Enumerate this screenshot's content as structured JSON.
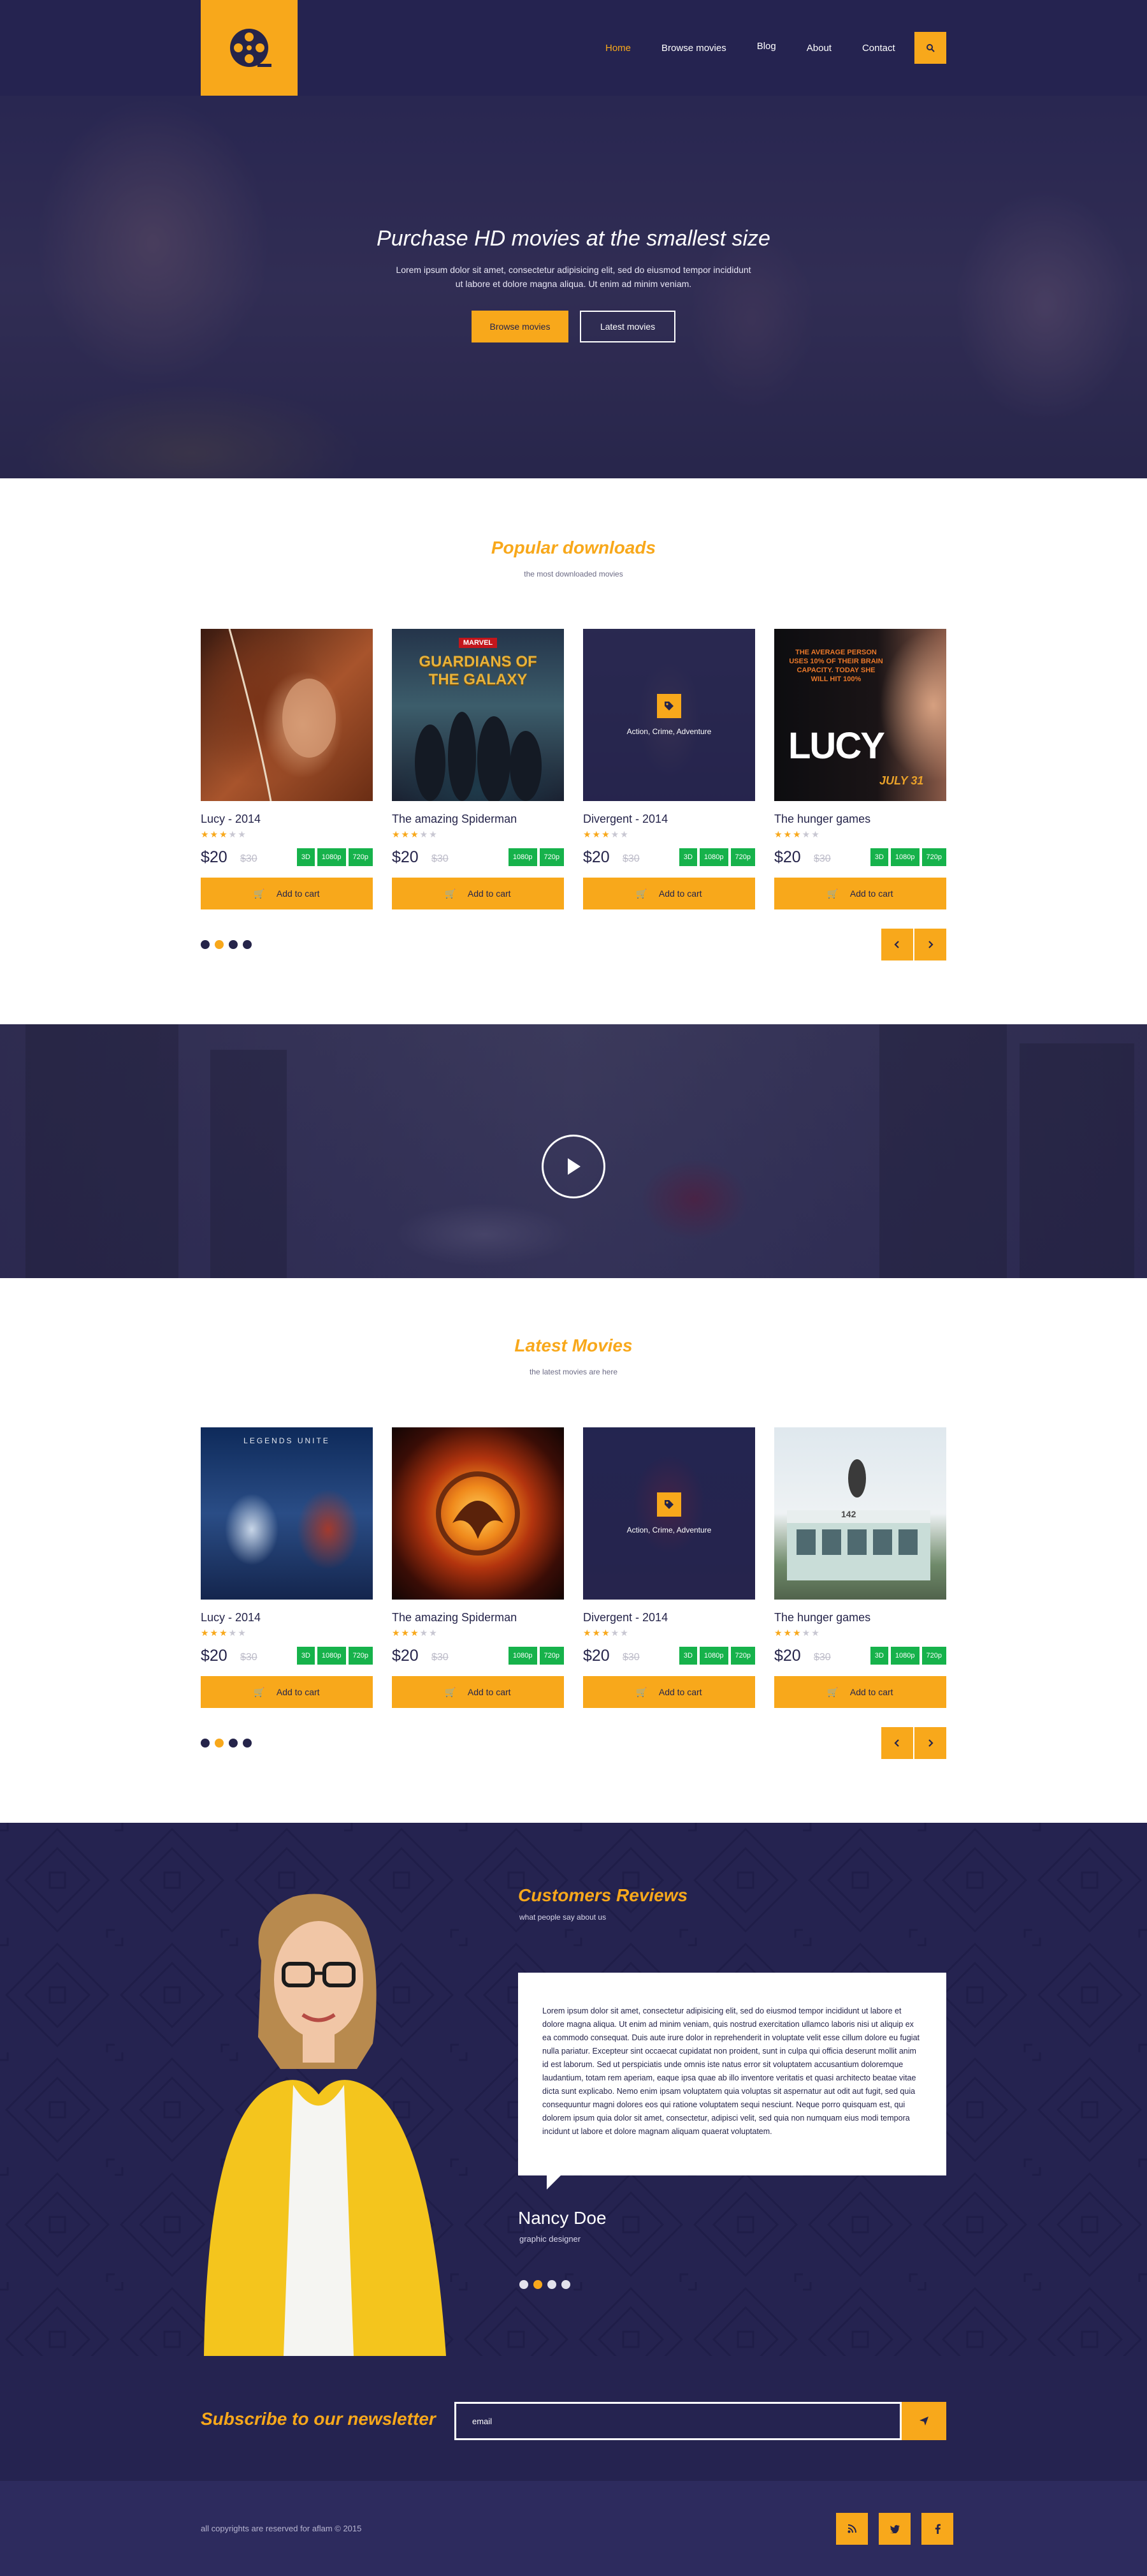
{
  "colors": {
    "navy": "#252350",
    "accent": "#f8a81b",
    "green": "#16b24b",
    "footer": "#2d2b5e"
  },
  "header": {
    "logo_icon": "film-reel-icon",
    "nav": [
      {
        "label": "Home",
        "active": true
      },
      {
        "label": "Browse movies",
        "active": false
      },
      {
        "label": "Blog",
        "active": false
      },
      {
        "label": "About",
        "active": false
      },
      {
        "label": "Contact",
        "active": false
      }
    ],
    "search_icon": "search-icon"
  },
  "hero": {
    "title": "Purchase HD movies at the smallest size",
    "text": "Lorem ipsum dolor sit amet, consectetur adipisicing elit, sed do eiusmod tempor incididunt ut labore et dolore magna aliqua. Ut enim ad minim veniam.",
    "primary_button": "Browse movies",
    "secondary_button": "Latest movies"
  },
  "popular": {
    "title": "Popular downloads",
    "subtitle": "the most downloaded movies",
    "items": [
      {
        "name": "Lucy - 2014",
        "rating": 3,
        "price": "$20",
        "old_price": "$30",
        "badges": [
          "3D",
          "1080p",
          "720p"
        ],
        "cart": "Add to cart"
      },
      {
        "name": "The amazing Spiderman",
        "rating": 3,
        "price": "$20",
        "old_price": "$30",
        "badges": [
          "1080p",
          "720p"
        ],
        "cart": "Add to cart"
      },
      {
        "name": "Divergent - 2014",
        "rating": 3,
        "price": "$20",
        "old_price": "$30",
        "badges": [
          "3D",
          "1080p",
          "720p"
        ],
        "cart": "Add to cart",
        "genre": "Action, Crime, Adventure"
      },
      {
        "name": "The hunger games",
        "rating": 3,
        "price": "$20",
        "old_price": "$30",
        "badges": [
          "3D",
          "1080p",
          "720p"
        ],
        "cart": "Add to cart"
      }
    ],
    "poster_text": {
      "guardians_top": "MARVEL",
      "guardians_title": "GUARDIANS OF THE GALAXY",
      "lucy_tagline": "THE AVERAGE PERSON USES 10% OF THEIR BRAIN CAPACITY. TODAY SHE WILL HIT 100%",
      "lucy_title": "LUCY",
      "lucy_date": "JULY 31"
    },
    "active_dot": 1
  },
  "latest": {
    "title": "Latest Movies",
    "subtitle": "the latest movies are here",
    "items": [
      {
        "name": "Lucy - 2014",
        "rating": 3,
        "price": "$20",
        "old_price": "$30",
        "badges": [
          "3D",
          "1080p",
          "720p"
        ],
        "cart": "Add to cart"
      },
      {
        "name": "The amazing Spiderman",
        "rating": 3,
        "price": "$20",
        "old_price": "",
        "badges": [
          "1080p",
          "720p"
        ],
        "cart": "Add to cart"
      },
      {
        "name": "Divergent - 2014",
        "rating": 3,
        "price": "$20",
        "old_price": "$30",
        "badges": [
          "3D",
          "1080p",
          "720p"
        ],
        "cart": "Add to cart",
        "genre": "Action, Crime, Adventure"
      },
      {
        "name": "The hunger games",
        "rating": 3,
        "price": "$20",
        "old_price": "$30",
        "badges": [
          "3D",
          "1080p",
          "720p"
        ],
        "cart": "Add to cart"
      }
    ],
    "poster_text": {
      "legends": "LEGENDS UNITE",
      "bus_number": "142"
    },
    "active_dot": 1
  },
  "reviews": {
    "title": "Customers Reviews",
    "subtitle": "what people say about us",
    "text": "Lorem ipsum dolor sit amet, consectetur adipisicing elit, sed do eiusmod tempor incididunt ut labore et dolore magna aliqua. Ut enim ad minim veniam, quis nostrud exercitation ullamco laboris nisi ut aliquip ex ea commodo consequat. Duis aute irure dolor in reprehenderit in voluptate velit esse cillum dolore eu fugiat nulla pariatur. Excepteur sint occaecat cupidatat non proident, sunt in culpa qui officia deserunt mollit anim id est laborum. Sed ut perspiciatis unde omnis iste natus error sit voluptatem accusantium doloremque laudantium, totam rem aperiam, eaque ipsa quae ab illo inventore veritatis et quasi architecto beatae vitae dicta sunt explicabo. Nemo enim ipsam voluptatem quia voluptas sit aspernatur aut odit aut fugit, sed quia consequuntur magni dolores eos qui ratione voluptatem sequi nesciunt. Neque porro quisquam est, qui dolorem ipsum quia dolor sit amet, consectetur, adipisci velit, sed quia non numquam eius modi tempora incidunt ut labore et dolore magnam aliquam quaerat voluptatem.",
    "name": "Nancy Doe",
    "role": "graphic designer",
    "active_dot": 1
  },
  "newsletter": {
    "title": "Subscribe to our newsletter",
    "placeholder": "email",
    "send_icon": "paper-plane-icon"
  },
  "footer": {
    "copyright": "all copyrights are reserved for aflam © 2015",
    "social": [
      {
        "icon": "rss-icon",
        "glyph": "ʃ"
      },
      {
        "icon": "twitter-icon",
        "glyph": "t"
      },
      {
        "icon": "facebook-icon",
        "glyph": "f"
      }
    ]
  }
}
